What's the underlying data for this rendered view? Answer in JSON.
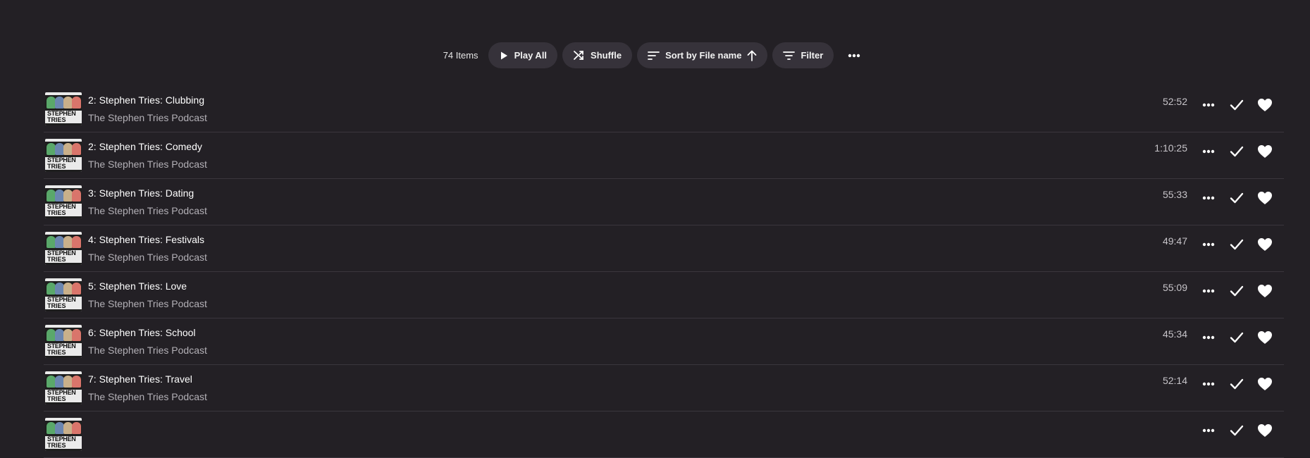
{
  "toolbar": {
    "count": "74 Items",
    "play_all": "Play All",
    "shuffle": "Shuffle",
    "sort": "Sort by File name",
    "filter": "Filter"
  },
  "icons": [
    "play-icon",
    "shuffle-icon",
    "sort-icon",
    "arrow-up-icon",
    "filter-icon",
    "more-icon",
    "check-icon",
    "heart-icon"
  ],
  "colors": {
    "background": "#232025",
    "pill": "#36323a"
  },
  "episodes": [
    {
      "title": "2: Stephen Tries: Clubbing",
      "podcast": "The Stephen Tries Podcast",
      "duration": "52:52"
    },
    {
      "title": "2: Stephen Tries: Comedy",
      "podcast": "The Stephen Tries Podcast",
      "duration": "1:10:25"
    },
    {
      "title": "3: Stephen Tries: Dating",
      "podcast": "The Stephen Tries Podcast",
      "duration": "55:33"
    },
    {
      "title": "4: Stephen Tries: Festivals",
      "podcast": "The Stephen Tries Podcast",
      "duration": "49:47"
    },
    {
      "title": "5: Stephen Tries: Love",
      "podcast": "The Stephen Tries Podcast",
      "duration": "55:09"
    },
    {
      "title": "6: Stephen Tries: School",
      "podcast": "The Stephen Tries Podcast",
      "duration": "45:34"
    },
    {
      "title": "7: Stephen Tries: Travel",
      "podcast": "The Stephen Tries Podcast",
      "duration": "52:14"
    },
    {
      "title": "",
      "podcast": "",
      "duration": ""
    }
  ],
  "thumb": {
    "line1": "STEPHEN",
    "line2": "TRIES"
  }
}
